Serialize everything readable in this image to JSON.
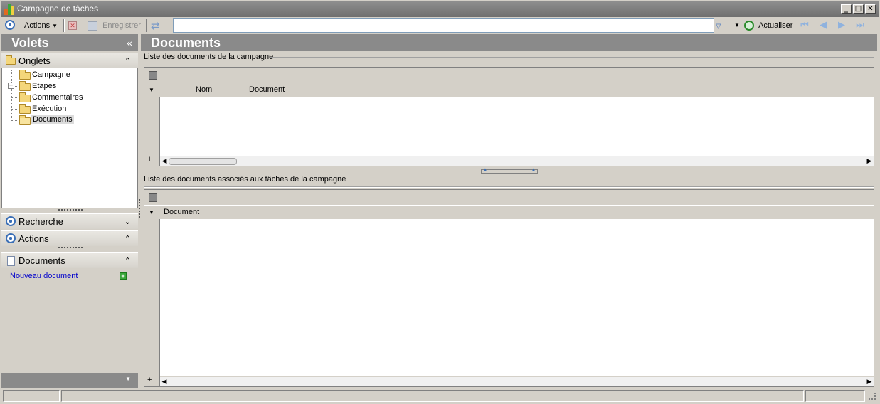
{
  "window": {
    "title": "Campagne de tâches",
    "controls": [
      "_",
      "□",
      "✕"
    ]
  },
  "toolbar": {
    "actions_label": "Actions",
    "save_label": "Enregistrer",
    "search_value": "",
    "refresh_label": "Actualiser"
  },
  "left_panel": {
    "title": "Volets",
    "collapse_glyph": "«",
    "groups": {
      "onglets": {
        "label": "Onglets",
        "chevron": "⌃"
      },
      "recherche": {
        "label": "Recherche",
        "chevron": "⌄"
      },
      "actions": {
        "label": "Actions",
        "chevron": "⌃"
      },
      "documents": {
        "label": "Documents",
        "chevron": "⌃"
      }
    },
    "tree": [
      {
        "label": "Campagne",
        "expandable": false,
        "selected": false
      },
      {
        "label": "Etapes",
        "expandable": true,
        "selected": false
      },
      {
        "label": "Commentaires",
        "expandable": false,
        "selected": false
      },
      {
        "label": "Exécution",
        "expandable": false,
        "selected": false
      },
      {
        "label": "Documents",
        "expandable": false,
        "selected": true
      }
    ],
    "new_document_link": "Nouveau document"
  },
  "main": {
    "title": "Documents",
    "section1": {
      "label": "Liste des documents de la campagne",
      "columns": [
        "Nom",
        "Document"
      ]
    },
    "section2": {
      "label": "Liste des documents associés aux tâches de la campagne",
      "columns": [
        "Document"
      ]
    }
  },
  "colors": {
    "header_bg": "#8a8a8a",
    "link": "#0000cc",
    "accent_blue": "#3b6fb6"
  }
}
